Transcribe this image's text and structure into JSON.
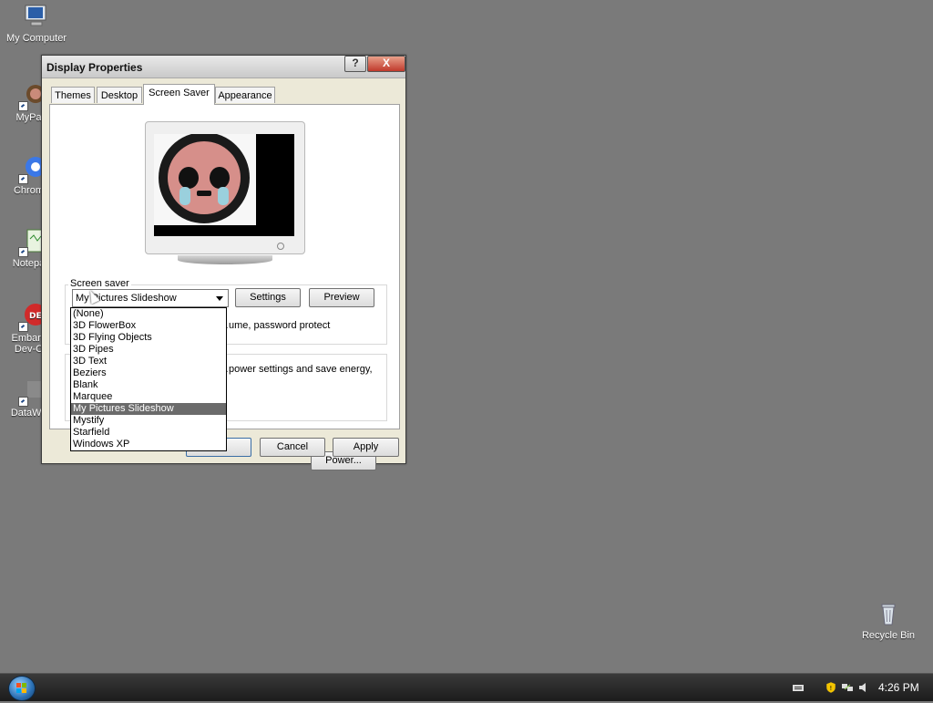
{
  "desktop": {
    "icons": [
      {
        "label": "My Computer",
        "icon": "computer-icon"
      },
      {
        "label": "MyPa…",
        "icon": "picture-shortcut-icon"
      },
      {
        "label": "Chrom…",
        "icon": "browser-shortcut-icon"
      },
      {
        "label": "Notepa…",
        "icon": "text-editor-shortcut-icon"
      },
      {
        "label": "Embarc…",
        "label2": "Dev-C…",
        "icon": "ide-shortcut-icon"
      },
      {
        "label": "DataWa…",
        "icon": "app-shortcut-icon"
      },
      {
        "label": "Recycle Bin",
        "icon": "recycle-bin-icon"
      }
    ]
  },
  "window": {
    "title": "Display Properties",
    "help_glyph": "?",
    "close_glyph": "X",
    "tabs": [
      {
        "label": "Themes",
        "active": false
      },
      {
        "label": "Desktop",
        "active": false
      },
      {
        "label": "Screen Saver",
        "active": true
      },
      {
        "label": "Appearance",
        "active": false
      }
    ],
    "screensaver": {
      "group_label": "Screen saver",
      "selected": "My Pictures Slideshow",
      "settings_label": "Settings",
      "preview_label": "Preview",
      "partial_text": "…ume, password protect",
      "options": [
        "(None)",
        "3D FlowerBox",
        "3D Flying Objects",
        "3D Pipes",
        "3D Text",
        "Beziers",
        "Blank",
        "Marquee",
        "My Pictures Slideshow",
        "Mystify",
        "Starfield",
        "Windows XP"
      ],
      "selected_index": 8
    },
    "power": {
      "partial_text": "…power settings and save energy,",
      "button_label": "Power..."
    },
    "buttons": {
      "ok": "OK",
      "cancel": "Cancel",
      "apply": "Apply"
    }
  },
  "taskbar": {
    "clock": "4:26 PM",
    "tray_icons": [
      "keyboard-icon",
      "security-shield-icon",
      "network-icon",
      "speaker-icon"
    ]
  },
  "colors": {
    "desktop_bg": "#7a7a7a",
    "window_bg": "#ece9d8",
    "selection_bg": "#6b6b6b",
    "close_button": "#c0392b"
  }
}
